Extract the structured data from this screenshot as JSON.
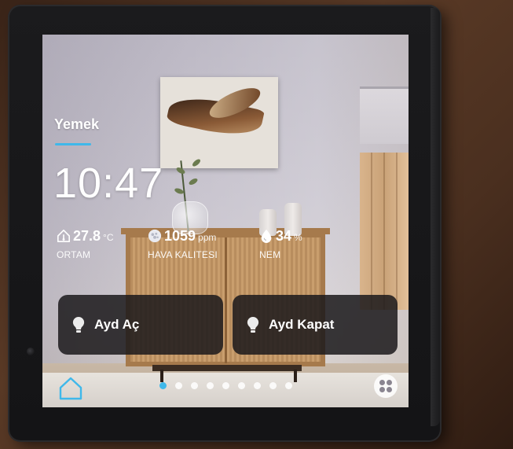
{
  "room": {
    "name": "Yemek"
  },
  "clock": {
    "time": "10:47"
  },
  "metrics": [
    {
      "value": "27.8",
      "unit": "°C",
      "label": "ORTAM",
      "icon": "home-thermometer-icon"
    },
    {
      "value": "1059",
      "unit": "ppm",
      "label": "HAVA KALITESI",
      "icon": "air-quality-icon"
    },
    {
      "value": "34",
      "unit": "%",
      "label": "NEM",
      "icon": "droplet-icon"
    }
  ],
  "scenes": [
    {
      "label": "Ayd Aç",
      "icon": "lightbulb-icon"
    },
    {
      "label": "Ayd Kapat",
      "icon": "lightbulb-icon"
    }
  ],
  "pagination": {
    "active_page": 1,
    "total_pages": 9
  },
  "colors": {
    "accent": "#3fb8ea",
    "button_bg": "#1c1a1c",
    "text": "#ffffff"
  }
}
